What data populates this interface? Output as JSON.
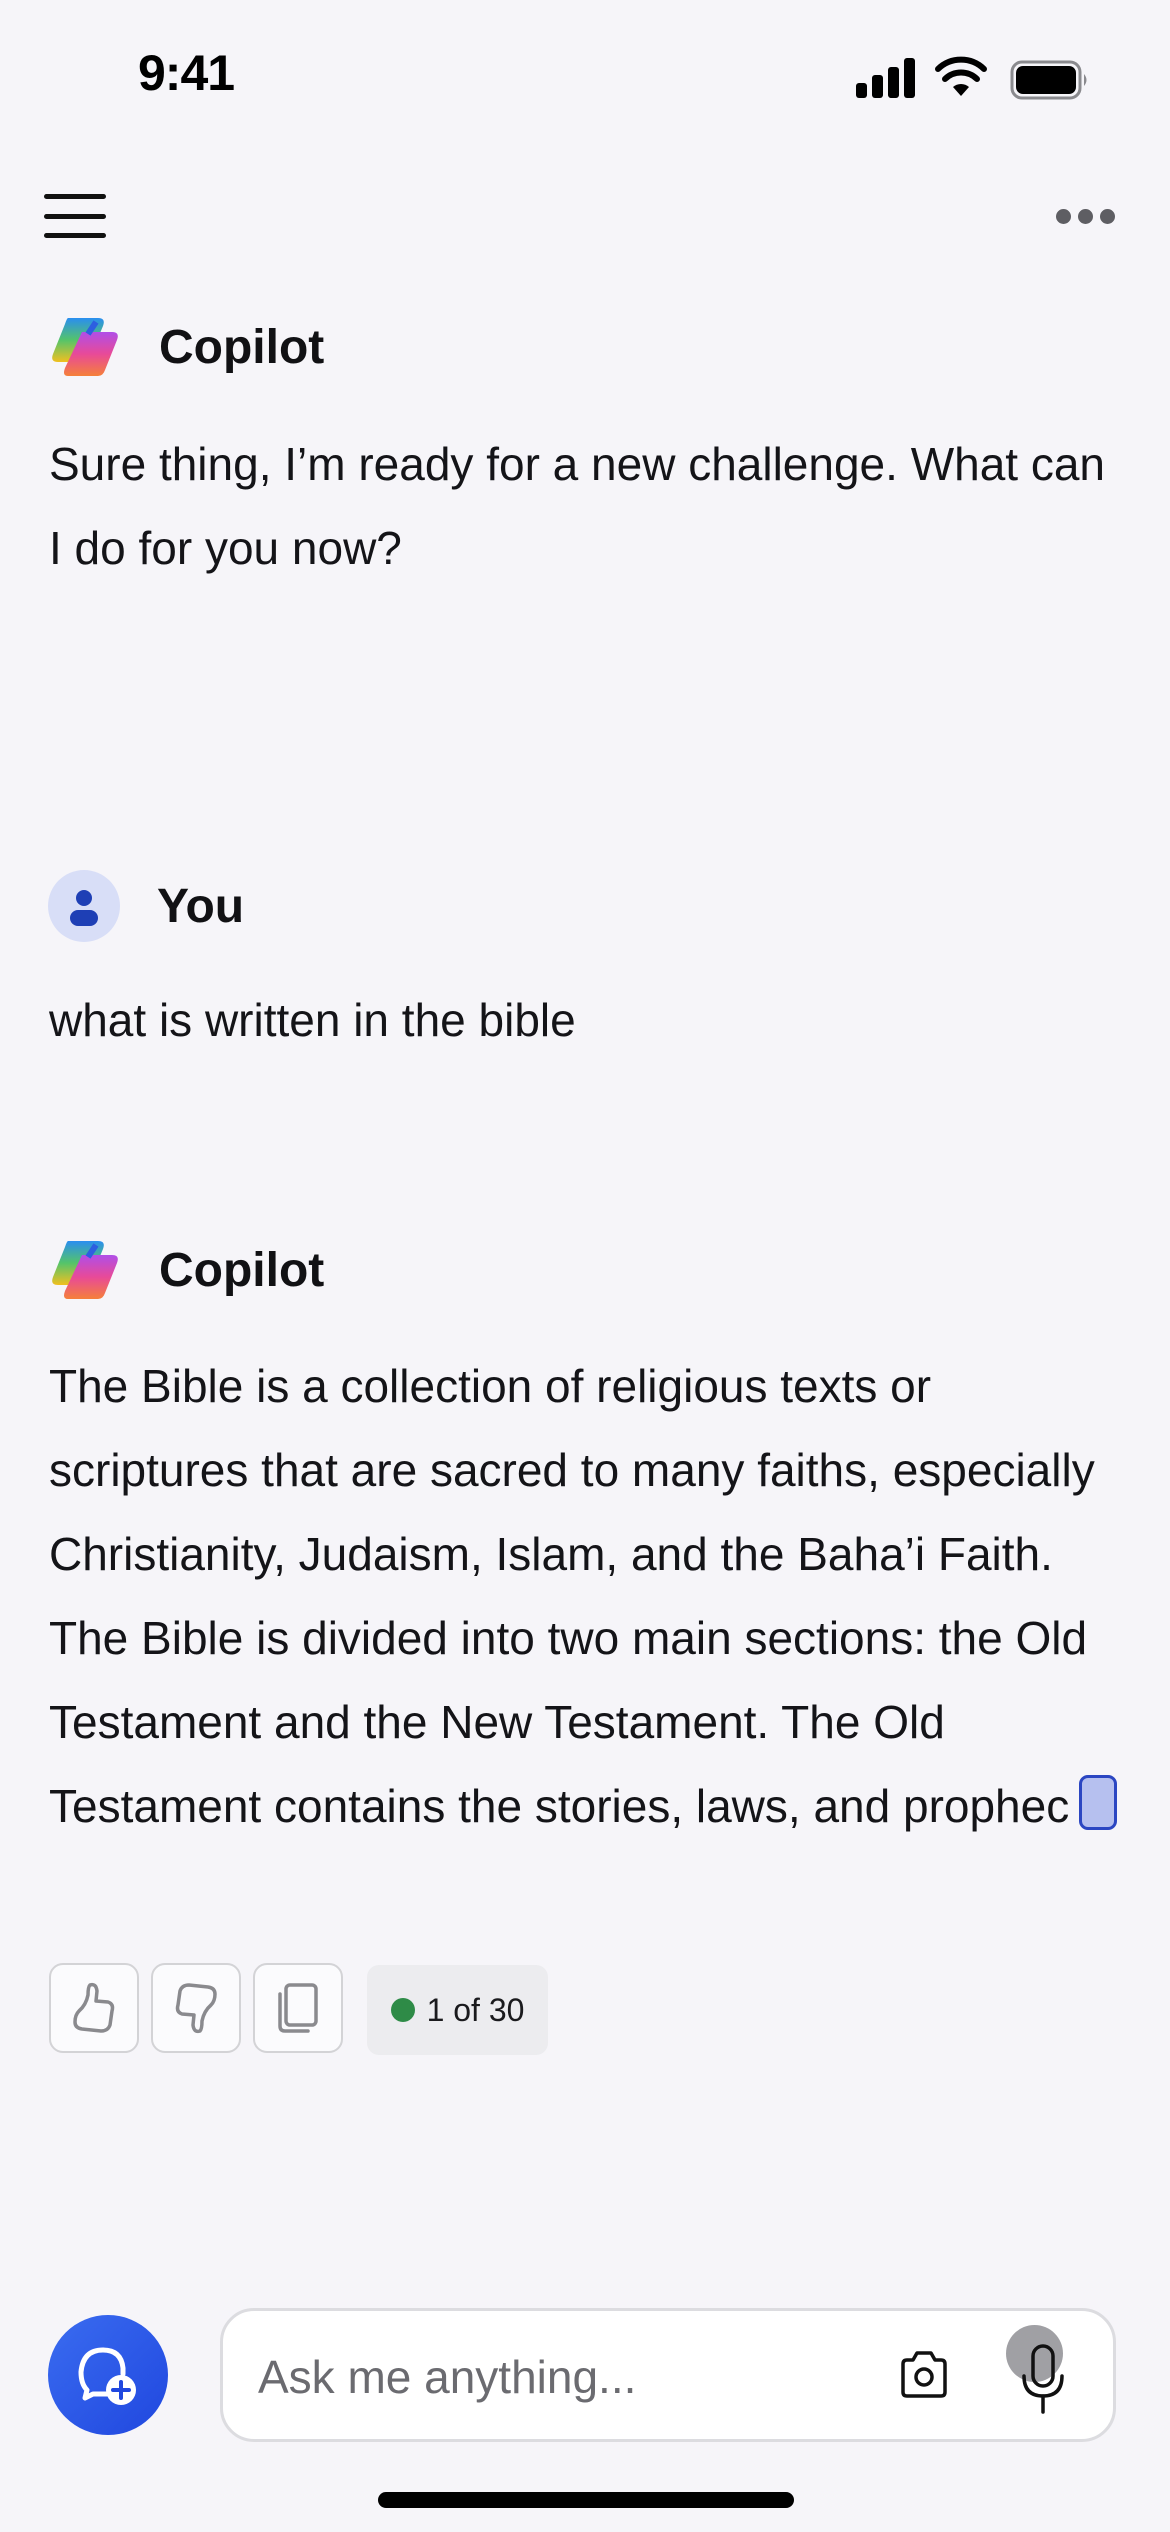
{
  "status_bar": {
    "time": "9:41",
    "icons": [
      "cellular-signal-icon",
      "wifi-icon",
      "battery-icon"
    ]
  },
  "nav": {
    "menu_icon": "hamburger-menu-icon",
    "more_icon": "more-options-icon"
  },
  "conversation": {
    "messages": [
      {
        "sender": "Copilot",
        "avatar_icon": "copilot-logo-icon",
        "text": "Sure thing, I’m ready for a new challenge. What can I do for you now?"
      },
      {
        "sender": "You",
        "avatar_icon": "user-avatar-icon",
        "text": "what is written in the bible"
      },
      {
        "sender": "Copilot",
        "avatar_icon": "copilot-logo-icon",
        "text": "The Bible is a collection of religious texts or scriptures that are sacred to many faiths, especially Christianity, Judaism, Islam, and the Baha’i Faith. The Bible is divided into two main sections: the Old Testament and the New Testament. The Old Testament contains the stories, laws, and prophec",
        "streaming": true,
        "actions": {
          "thumbs_up_icon": "thumbs-up-icon",
          "thumbs_down_icon": "thumbs-down-icon",
          "copy_icon": "copy-icon"
        },
        "turn_counter": "1 of 30",
        "turn_counter_status_color": "#2e8b47"
      }
    ]
  },
  "composer": {
    "new_chat_icon": "new-chat-icon",
    "placeholder": "Ask me anything...",
    "value": "",
    "camera_icon": "camera-icon",
    "mic_icon": "microphone-icon"
  },
  "colors": {
    "background": "#f6f5f9",
    "accent_blue": "#2b4fe3",
    "user_avatar_bg": "#d8def7",
    "user_avatar_fg": "#1e3fb5"
  }
}
